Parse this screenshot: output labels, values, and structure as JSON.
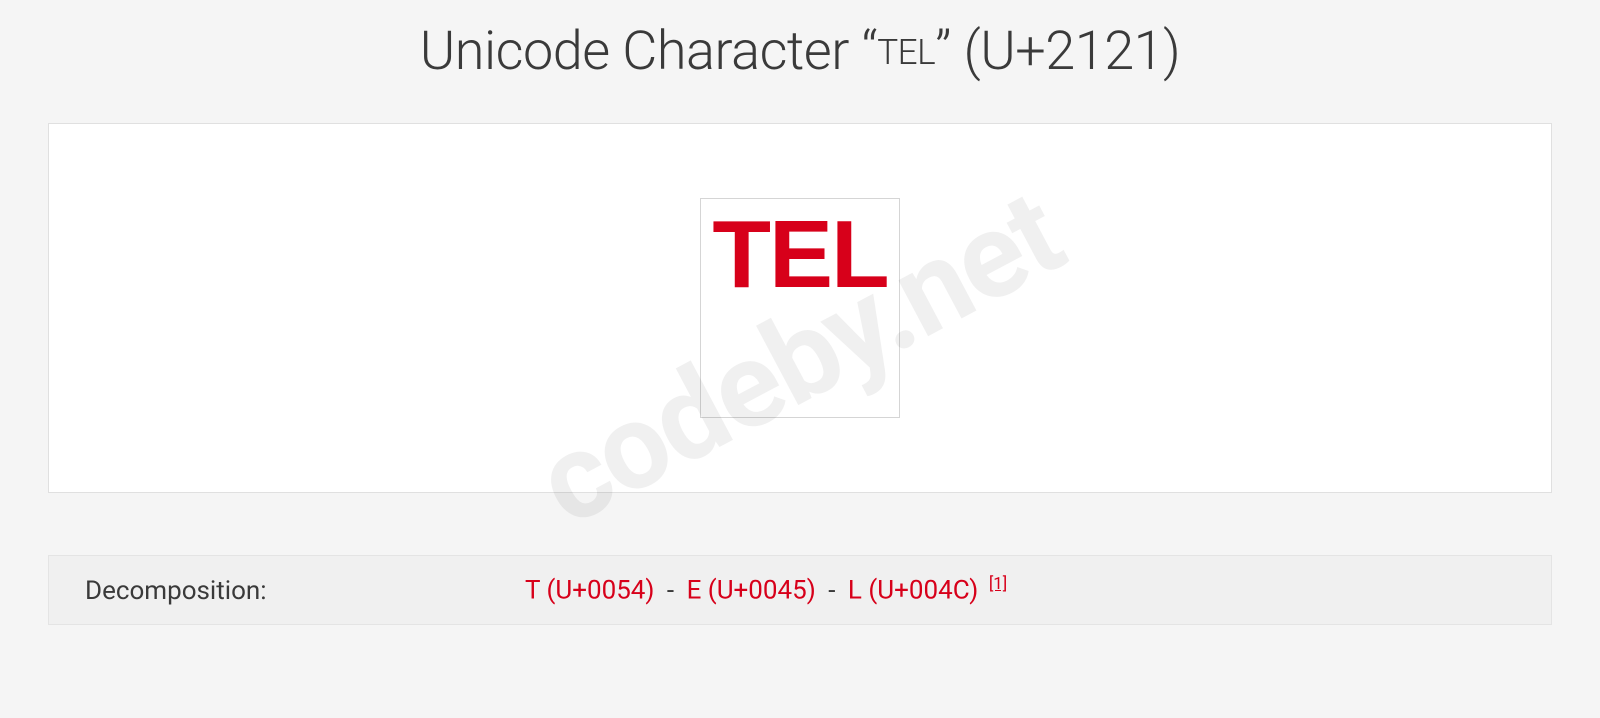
{
  "title": {
    "prefix": "Unicode Character “",
    "glyph": "TEL",
    "suffix": "” (U+2121)"
  },
  "display": {
    "glyph": "TEL"
  },
  "watermark": "codeby.net",
  "info": {
    "label": "Decomposition:",
    "parts": [
      {
        "text": "T (U+0054)"
      },
      {
        "text": "E (U+0045)"
      },
      {
        "text": "L (U+004C)"
      }
    ],
    "separator": "-",
    "ref": "[1]"
  }
}
